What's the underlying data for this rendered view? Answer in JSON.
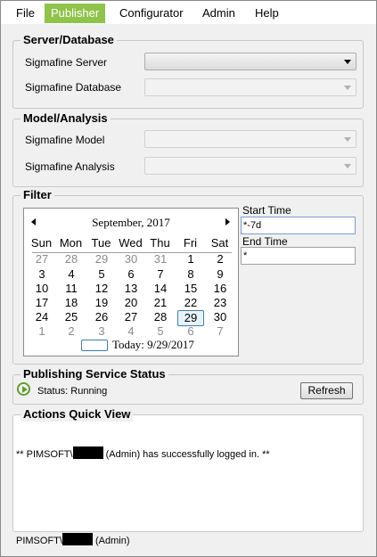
{
  "menu": [
    "File",
    "Publisher",
    "Configurator",
    "Admin",
    "Help"
  ],
  "server_group": {
    "title": "Server/Database",
    "server_label": "Sigmafine Server",
    "database_label": "Sigmafine Database"
  },
  "model_group": {
    "title": "Model/Analysis",
    "model_label": "Sigmafine Model",
    "analysis_label": "Sigmafine Analysis"
  },
  "filter": {
    "title": "Filter",
    "calendar": {
      "month_title": "September, 2017",
      "weekdays": [
        "Sun",
        "Mon",
        "Tue",
        "Wed",
        "Thu",
        "Fri",
        "Sat"
      ],
      "weeks": [
        [
          "27",
          "28",
          "29",
          "30",
          "31",
          "1",
          "2"
        ],
        [
          "3",
          "4",
          "5",
          "6",
          "7",
          "8",
          "9"
        ],
        [
          "10",
          "11",
          "12",
          "13",
          "14",
          "15",
          "16"
        ],
        [
          "17",
          "18",
          "19",
          "20",
          "21",
          "22",
          "23"
        ],
        [
          "24",
          "25",
          "26",
          "27",
          "28",
          "29",
          "30"
        ],
        [
          "1",
          "2",
          "3",
          "4",
          "5",
          "6",
          "7"
        ]
      ],
      "today_label": "Today: 9/29/2017",
      "selected_day": "29"
    },
    "start_time_label": "Start Time",
    "start_time_value": "*-7d",
    "end_time_label": "End Time",
    "end_time_value": "*"
  },
  "publishing": {
    "title": "Publishing Service Status",
    "status_text": "Status: Running",
    "refresh_label": "Refresh",
    "status_color": "#5aa02c"
  },
  "actions": {
    "title": "Actions Quick View",
    "message_prefix": "** PIMSOFT\\",
    "message_suffix": " (Admin) has successfully logged in. **"
  },
  "statusbar": {
    "user_prefix": "PIMSOFT\\",
    "user_suffix": " (Admin)"
  },
  "colors": {
    "accent": "#8fc34a",
    "selection_border": "#3c7fb1"
  }
}
